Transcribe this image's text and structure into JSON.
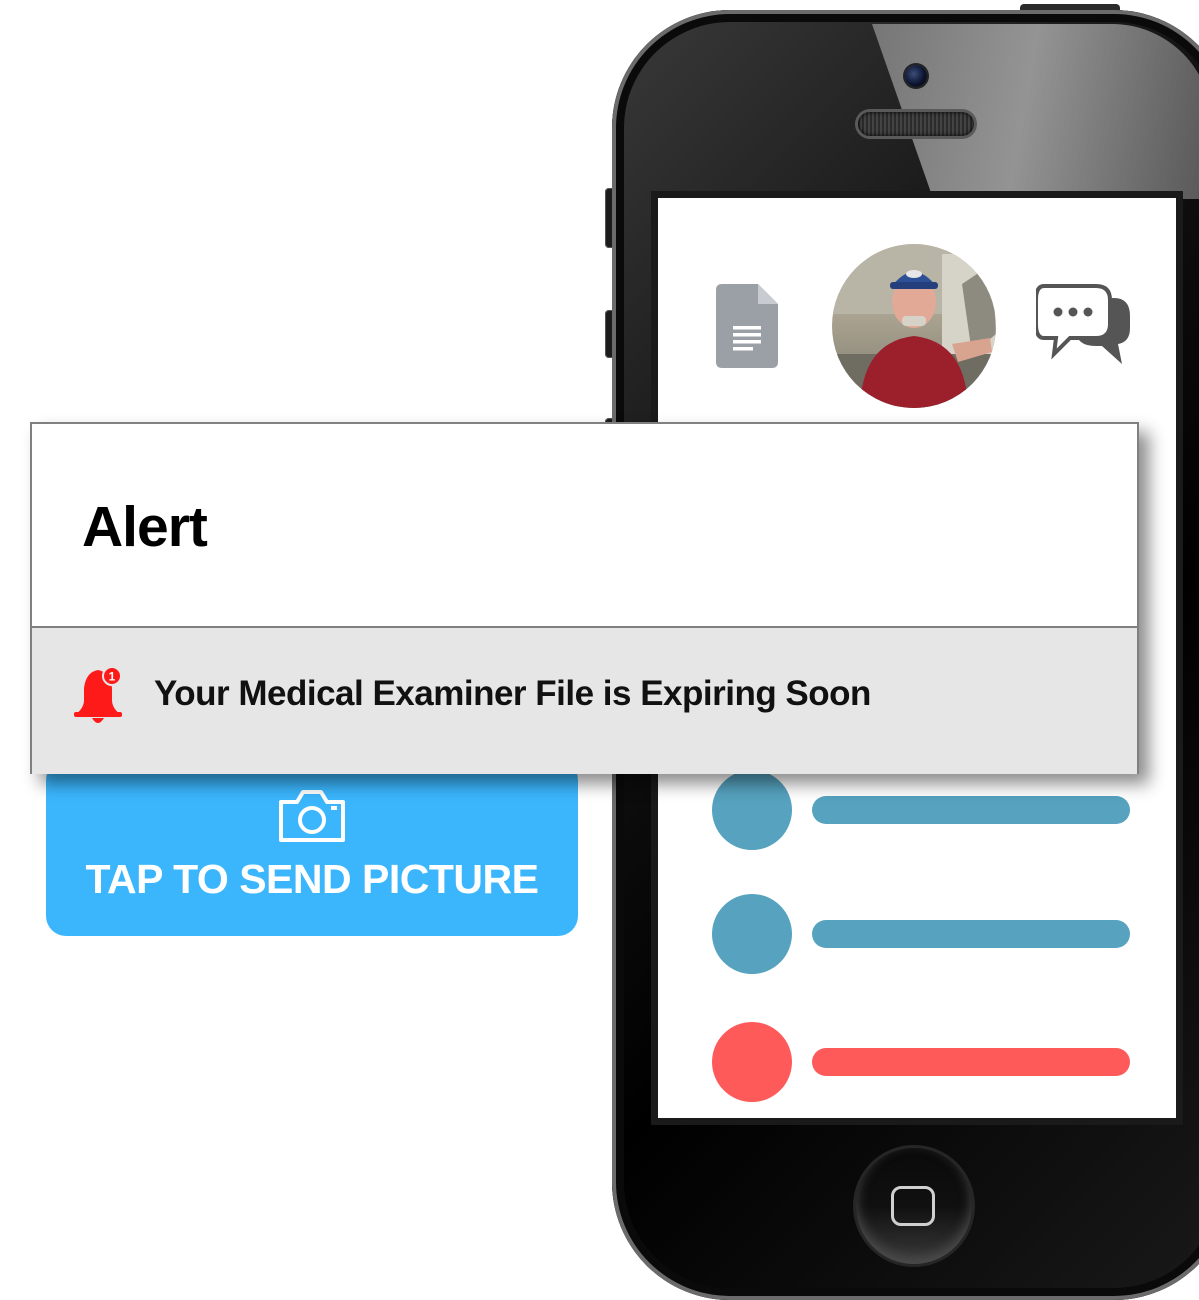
{
  "alert": {
    "title": "Alert",
    "message": "Your Medical Examiner File is Expiring Soon",
    "badge_count": "1"
  },
  "picture_button": {
    "label": "TAP TO SEND PICTURE",
    "icon": "camera-icon"
  },
  "phone_screen": {
    "icons": [
      "document-icon",
      "profile-avatar",
      "chat-bubbles-icon"
    ],
    "list_items": [
      {
        "color": "#56a2bf"
      },
      {
        "color": "#56a2bf"
      },
      {
        "color": "#ff5a5a"
      }
    ]
  },
  "colors": {
    "accent_blue": "#3bb6fd",
    "alert_red": "#ff1a1a",
    "list_blue": "#56a2bf",
    "list_red": "#ff5a5a"
  }
}
